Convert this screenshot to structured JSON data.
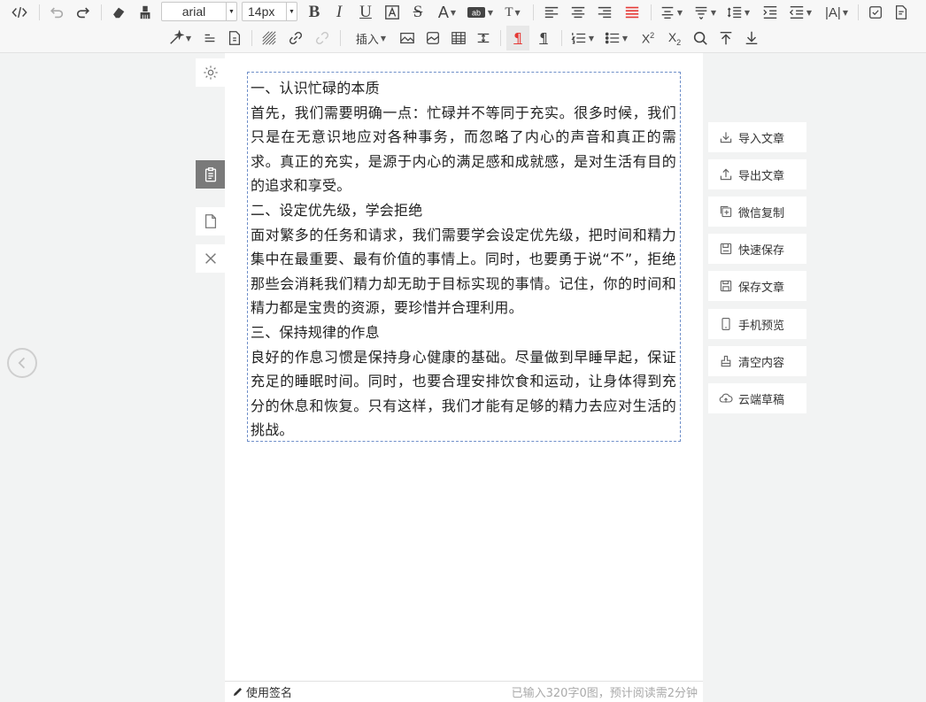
{
  "toolbar": {
    "font_family": "arial",
    "font_size": "14px",
    "insert_label": "插入"
  },
  "colors": {
    "page_bg": "#f2f3f3",
    "canvas_bg": "#ffffff",
    "content_border": "#6f8fc9",
    "active_red": "#e53935"
  },
  "side": {
    "icons": [
      "gear-icon",
      "clipboard-icon",
      "document-icon",
      "close-icon"
    ],
    "back_icon": "chevron-left-icon"
  },
  "article": {
    "paragraphs": [
      "一、认识忙碌的本质",
      "首先，我们需要明确一点：忙碌并不等同于充实。很多时候，我们只是在无意识地应对各种事务，而忽略了内心的声音和真正的需求。真正的充实，是源于内心的满足感和成就感，是对生活有目的的追求和享受。",
      "二、设定优先级，学会拒绝",
      "面对繁多的任务和请求，我们需要学会设定优先级，把时间和精力集中在最重要、最有价值的事情上。同时，也要勇于说“不”，拒绝那些会消耗我们精力却无助于目标实现的事情。记住，你的时间和精力都是宝贵的资源，要珍惜并合理利用。",
      "三、保持规律的作息",
      "良好的作息习惯是保持身心健康的基础。尽量做到早睡早起，保证充足的睡眠时间。同时，也要合理安排饮食和运动，让身体得到充分的休息和恢复。只有这样，我们才能有足够的精力去应对生活的挑战。"
    ]
  },
  "status": {
    "signature_label": "使用签名",
    "stats_text": "已输入320字0图，预计阅读需2分钟"
  },
  "right_panel": {
    "buttons": [
      {
        "label": "导入文章",
        "icon": "import-icon"
      },
      {
        "label": "导出文章",
        "icon": "export-icon"
      },
      {
        "label": "微信复制",
        "icon": "copy-icon"
      },
      {
        "label": "快速保存",
        "icon": "save-icon"
      },
      {
        "label": "保存文章",
        "icon": "save-file-icon"
      },
      {
        "label": "手机预览",
        "icon": "phone-icon"
      },
      {
        "label": "清空内容",
        "icon": "clear-icon"
      },
      {
        "label": "云端草稿",
        "icon": "cloud-icon"
      }
    ]
  }
}
